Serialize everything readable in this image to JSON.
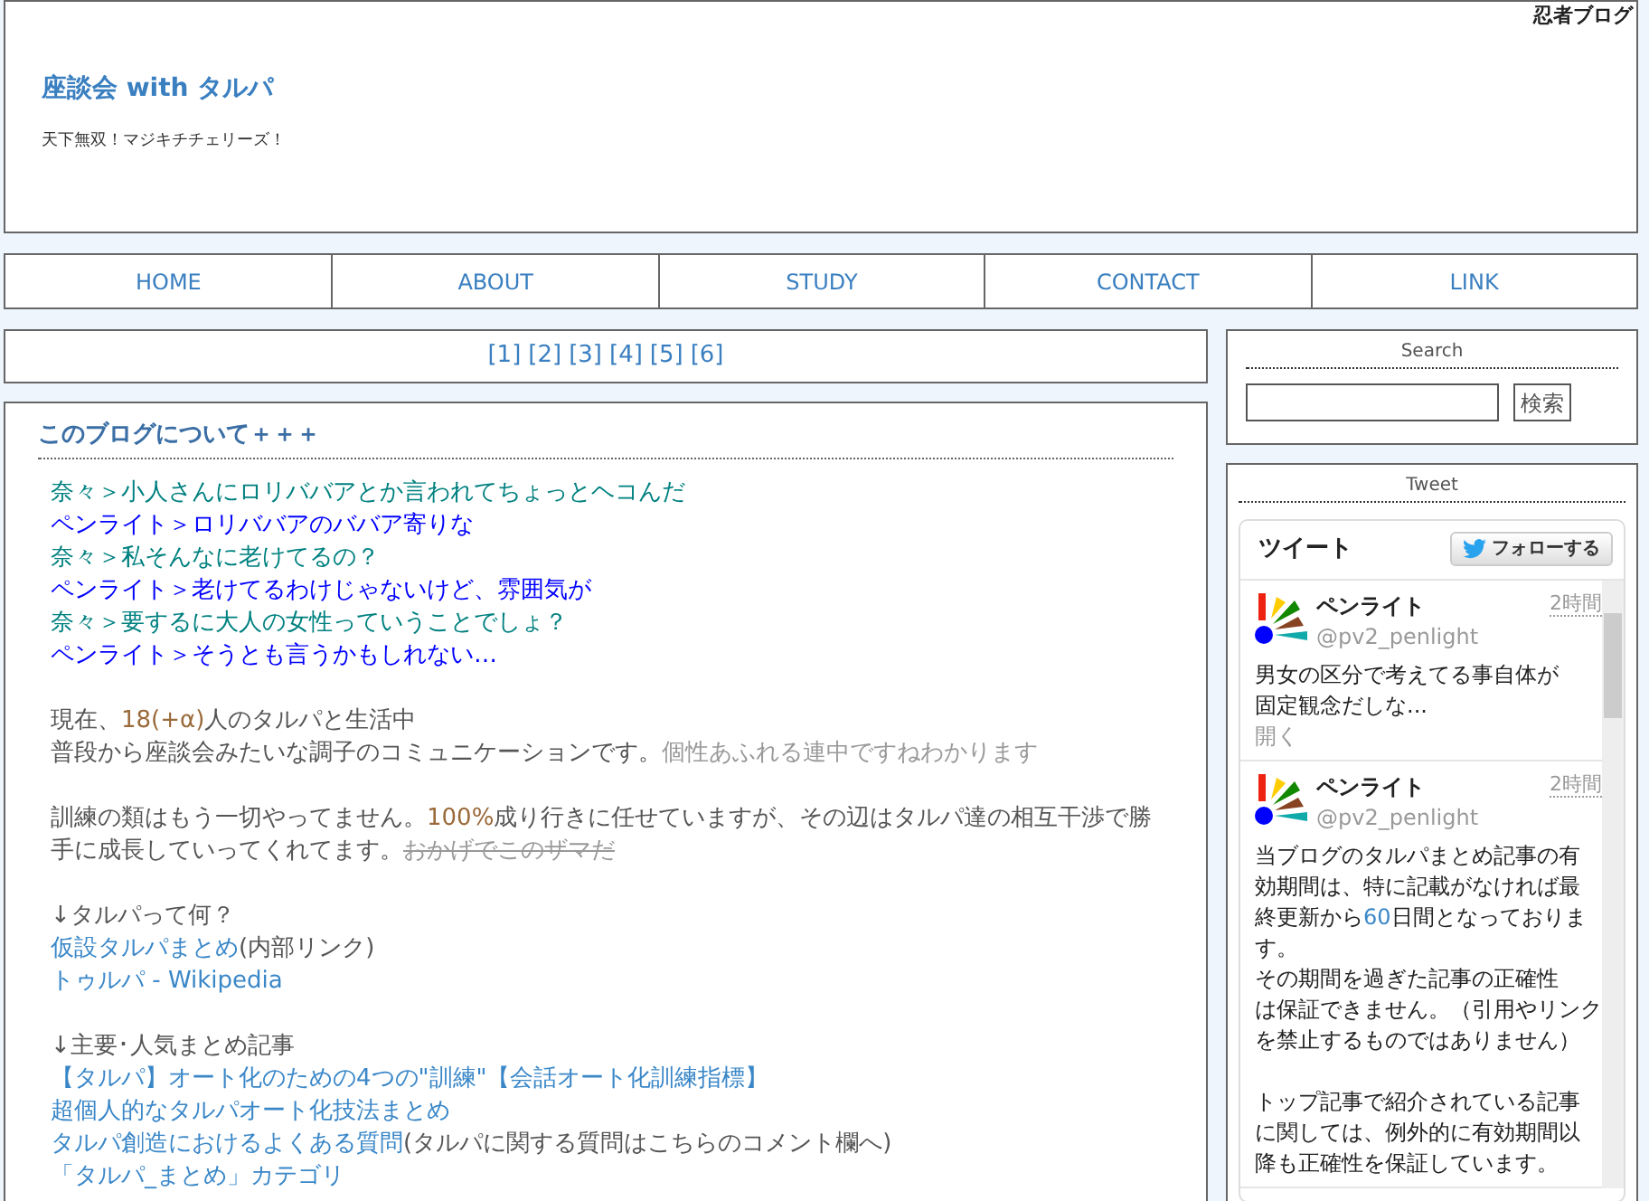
{
  "header": {
    "site_link": "忍者ブログ",
    "title": "座談会 with タルパ",
    "tagline": "天下無双！マジキチチェリーズ！"
  },
  "nav": {
    "items": [
      "HOME",
      "ABOUT",
      "STUDY",
      "CONTACT",
      "LINK"
    ]
  },
  "pager": {
    "pages": [
      "[1]",
      "[2]",
      "[3]",
      "[4]",
      "[5]",
      "[6]"
    ]
  },
  "article": {
    "title": "このブログについて＋＋＋",
    "dialogue": [
      {
        "text": "奈々＞小人さんにロリババアとか言われてちょっとヘコんだ",
        "color": "#008080"
      },
      {
        "text": "ペンライト＞ロリババアのババア寄りな",
        "color": "#0000ff"
      },
      {
        "text": "奈々＞私そんなに老けてるの？",
        "color": "#008080"
      },
      {
        "text": "ペンライト＞老けてるわけじゃないけど、雰囲気が",
        "color": "#0000ff"
      },
      {
        "text": "奈々＞要するに大人の女性っていうことでしょ？",
        "color": "#008080"
      },
      {
        "text": "ペンライト＞そうとも言うかもしれない…",
        "color": "#0000ff"
      }
    ],
    "sections": [
      {
        "lines": [
          [
            {
              "kind": "text",
              "text": "現在、"
            },
            {
              "kind": "accent",
              "text": "18(+α)"
            },
            {
              "kind": "text",
              "text": "人のタルパと生活中"
            }
          ],
          [
            {
              "kind": "text",
              "text": "普段から座談会みたいな調子のコミュニケーションです。"
            },
            {
              "kind": "muted",
              "text": "個性あふれる連中ですねわかります"
            }
          ]
        ]
      },
      {
        "lines": [
          [
            {
              "kind": "text",
              "text": "訓練の類はもう一切やってません。"
            },
            {
              "kind": "accent",
              "text": "100%"
            },
            {
              "kind": "text",
              "text": "成り行きに任せていますが、その辺はタルパ達の相互干渉で勝手に成長していってくれてます。"
            },
            {
              "kind": "struck",
              "text": "おかげでこのザマだ"
            }
          ]
        ]
      },
      {
        "lines": [
          [
            {
              "kind": "text",
              "text": "↓タルパって何？"
            }
          ],
          [
            {
              "kind": "link",
              "text": "仮設タルパまとめ"
            },
            {
              "kind": "text",
              "text": "(内部リンク)"
            }
          ],
          [
            {
              "kind": "link",
              "text": "トゥルパ - Wikipedia"
            }
          ]
        ]
      },
      {
        "lines": [
          [
            {
              "kind": "text",
              "text": "↓主要･人気まとめ記事"
            }
          ],
          [
            {
              "kind": "link",
              "text": "【タルパ】オート化のための4つの\"訓練\"【会話オート化訓練指標】"
            }
          ],
          [
            {
              "kind": "link",
              "text": "超個人的なタルパオート化技法まとめ"
            }
          ],
          [
            {
              "kind": "link",
              "text": "タルパ創造におけるよくある質問"
            },
            {
              "kind": "text",
              "text": "(タルパに関する質問はこちらのコメント欄へ)"
            }
          ],
          [
            {
              "kind": "link",
              "text": "「タルパ_まとめ」カテゴリ"
            }
          ]
        ]
      }
    ]
  },
  "search": {
    "title": "Search",
    "button": "検索"
  },
  "tweet_box": {
    "title": "Tweet",
    "widget_title": "ツイート",
    "follow_button": "フォローする",
    "tweets": [
      {
        "name": "ペンライト",
        "handle": "@pv2_penlight",
        "time": "2時間",
        "open_link": "開く",
        "paragraphs": [
          [
            [
              {
                "kind": "text",
                "text": "男女の区分で考えてる事自体が"
              }
            ],
            [
              {
                "kind": "text",
                "text": "固定観念だしな..."
              }
            ]
          ]
        ]
      },
      {
        "name": "ペンライト",
        "handle": "@pv2_penlight",
        "time": "2時間",
        "paragraphs": [
          [
            [
              {
                "kind": "text",
                "text": "当ブログのタルパまとめ記事の有"
              }
            ],
            [
              {
                "kind": "text",
                "text": "効期間は、特に記載がなければ最"
              }
            ],
            [
              {
                "kind": "text",
                "text": "終更新から"
              },
              {
                "kind": "accent",
                "text": "60"
              },
              {
                "kind": "text",
                "text": "日間となっておりま"
              }
            ],
            [
              {
                "kind": "text",
                "text": "す。"
              }
            ],
            [
              {
                "kind": "text",
                "text": "その期間を過ぎた記事の正確性"
              }
            ],
            [
              {
                "kind": "text",
                "text": "は保証できません。（引用やリンク"
              }
            ],
            [
              {
                "kind": "text",
                "text": "を禁止するものではありません）"
              }
            ]
          ],
          [
            [
              {
                "kind": "text",
                "text": "トップ記事で紹介されている記事"
              }
            ],
            [
              {
                "kind": "text",
                "text": "に関しては、例外的に有効期間以"
              }
            ],
            [
              {
                "kind": "text",
                "text": "降も正確性を保証しています。"
              }
            ]
          ]
        ]
      }
    ]
  }
}
